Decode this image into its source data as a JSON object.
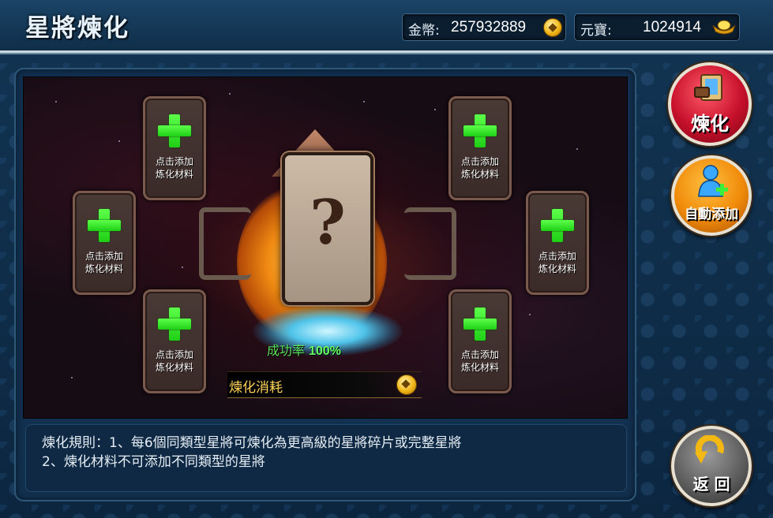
{
  "header": {
    "title": "星將煉化",
    "gold_label": "金幣:",
    "gold_value": "257932889",
    "yuanbao_label": "元寶:",
    "yuanbao_value": "1024914"
  },
  "slots": {
    "label_line1": "点击添加",
    "label_line2": "炼化材料"
  },
  "center": {
    "card_symbol": "?",
    "success_label": "成功率",
    "success_value": "100%",
    "cost_label": "煉化消耗"
  },
  "rules": {
    "line1": "煉化規則：1、每6個同類型星將可煉化為更高級的星將碎片或完整星將",
    "line2": "2、煉化材料不可添加不同類型的星將"
  },
  "buttons": {
    "refine_label": "煉化",
    "auto_add_label": "自動添加",
    "back_label": "返 回"
  },
  "icons": [
    "gold-coin-icon",
    "yuanbao-ingot-icon",
    "add-plus-icon",
    "refine-book-icon",
    "auto-add-person-icon",
    "return-arrow-icon"
  ],
  "colors": {
    "accent_green": "#5dff4a",
    "refine_red": "#c6102a",
    "auto_orange": "#f08a0a"
  }
}
